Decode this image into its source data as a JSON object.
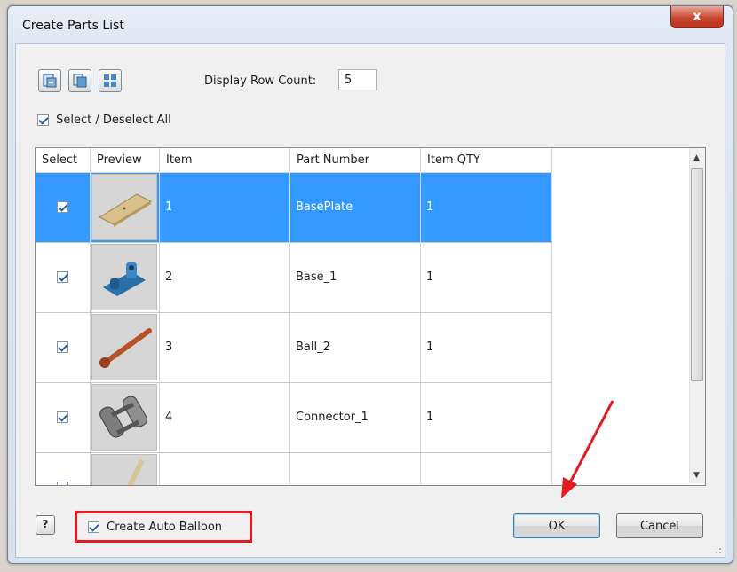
{
  "window": {
    "title": "Create Parts List",
    "close_glyph": "x"
  },
  "toolbar": {
    "display_row_count_label": "Display Row Count:",
    "display_row_count_value": "5"
  },
  "select_all": {
    "label": "Select / Deselect All",
    "checked": true
  },
  "grid": {
    "columns": [
      "Select",
      "Preview",
      "Item",
      "Part Number",
      "Item QTY"
    ],
    "rows": [
      {
        "item": "1",
        "part_number": "BasePlate",
        "qty": "1",
        "selected": true,
        "checked": true,
        "preview_icon": "baseplate-icon"
      },
      {
        "item": "2",
        "part_number": "Base_1",
        "qty": "1",
        "selected": false,
        "checked": true,
        "preview_icon": "base-part-icon"
      },
      {
        "item": "3",
        "part_number": "Ball_2",
        "qty": "1",
        "selected": false,
        "checked": true,
        "preview_icon": "ball-rod-icon"
      },
      {
        "item": "4",
        "part_number": "Connector_1",
        "qty": "1",
        "selected": false,
        "checked": true,
        "preview_icon": "connector-icon"
      }
    ]
  },
  "footer": {
    "help_glyph": "?",
    "auto_balloon_label": "Create Auto Balloon",
    "auto_balloon_checked": true,
    "ok_label": "OK",
    "cancel_label": "Cancel"
  },
  "colors": {
    "selection": "#3399ff",
    "annotation_red": "#e01c22"
  }
}
